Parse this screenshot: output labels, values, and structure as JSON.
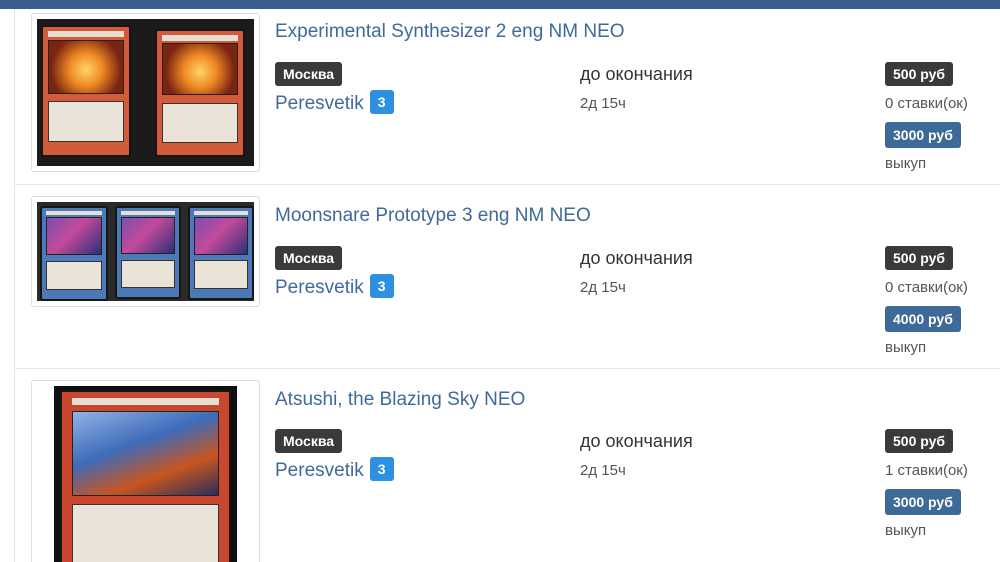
{
  "listings": [
    {
      "title": "Experimental Synthesizer 2 eng NM NEO",
      "city": "Москва",
      "seller": "Peresvetik",
      "rating": "3",
      "time_label": "до окончания",
      "time_left": "2д 15ч",
      "price": "500 руб",
      "bids": "0 ставки(ок)",
      "buyout_price": "3000 руб",
      "buyout_label": "выкуп"
    },
    {
      "title": "Moonsnare Prototype 3 eng NM NEO",
      "city": "Москва",
      "seller": "Peresvetik",
      "rating": "3",
      "time_label": "до окончания",
      "time_left": "2д 15ч",
      "price": "500 руб",
      "bids": "0 ставки(ок)",
      "buyout_price": "4000 руб",
      "buyout_label": "выкуп"
    },
    {
      "title": "Atsushi, the Blazing Sky NEO",
      "city": "Москва",
      "seller": "Peresvetik",
      "rating": "3",
      "time_label": "до окончания",
      "time_left": "2д 15ч",
      "price": "500 руб",
      "bids": "1 ставки(ок)",
      "buyout_price": "3000 руб",
      "buyout_label": "выкуп"
    }
  ],
  "colors": {
    "topbar": "#3b5e8c",
    "link": "#3e6a9a",
    "dark_badge": "#3a3a3a",
    "rating_badge": "#2f8fe0",
    "buyout_badge": "#3e6a9a"
  }
}
